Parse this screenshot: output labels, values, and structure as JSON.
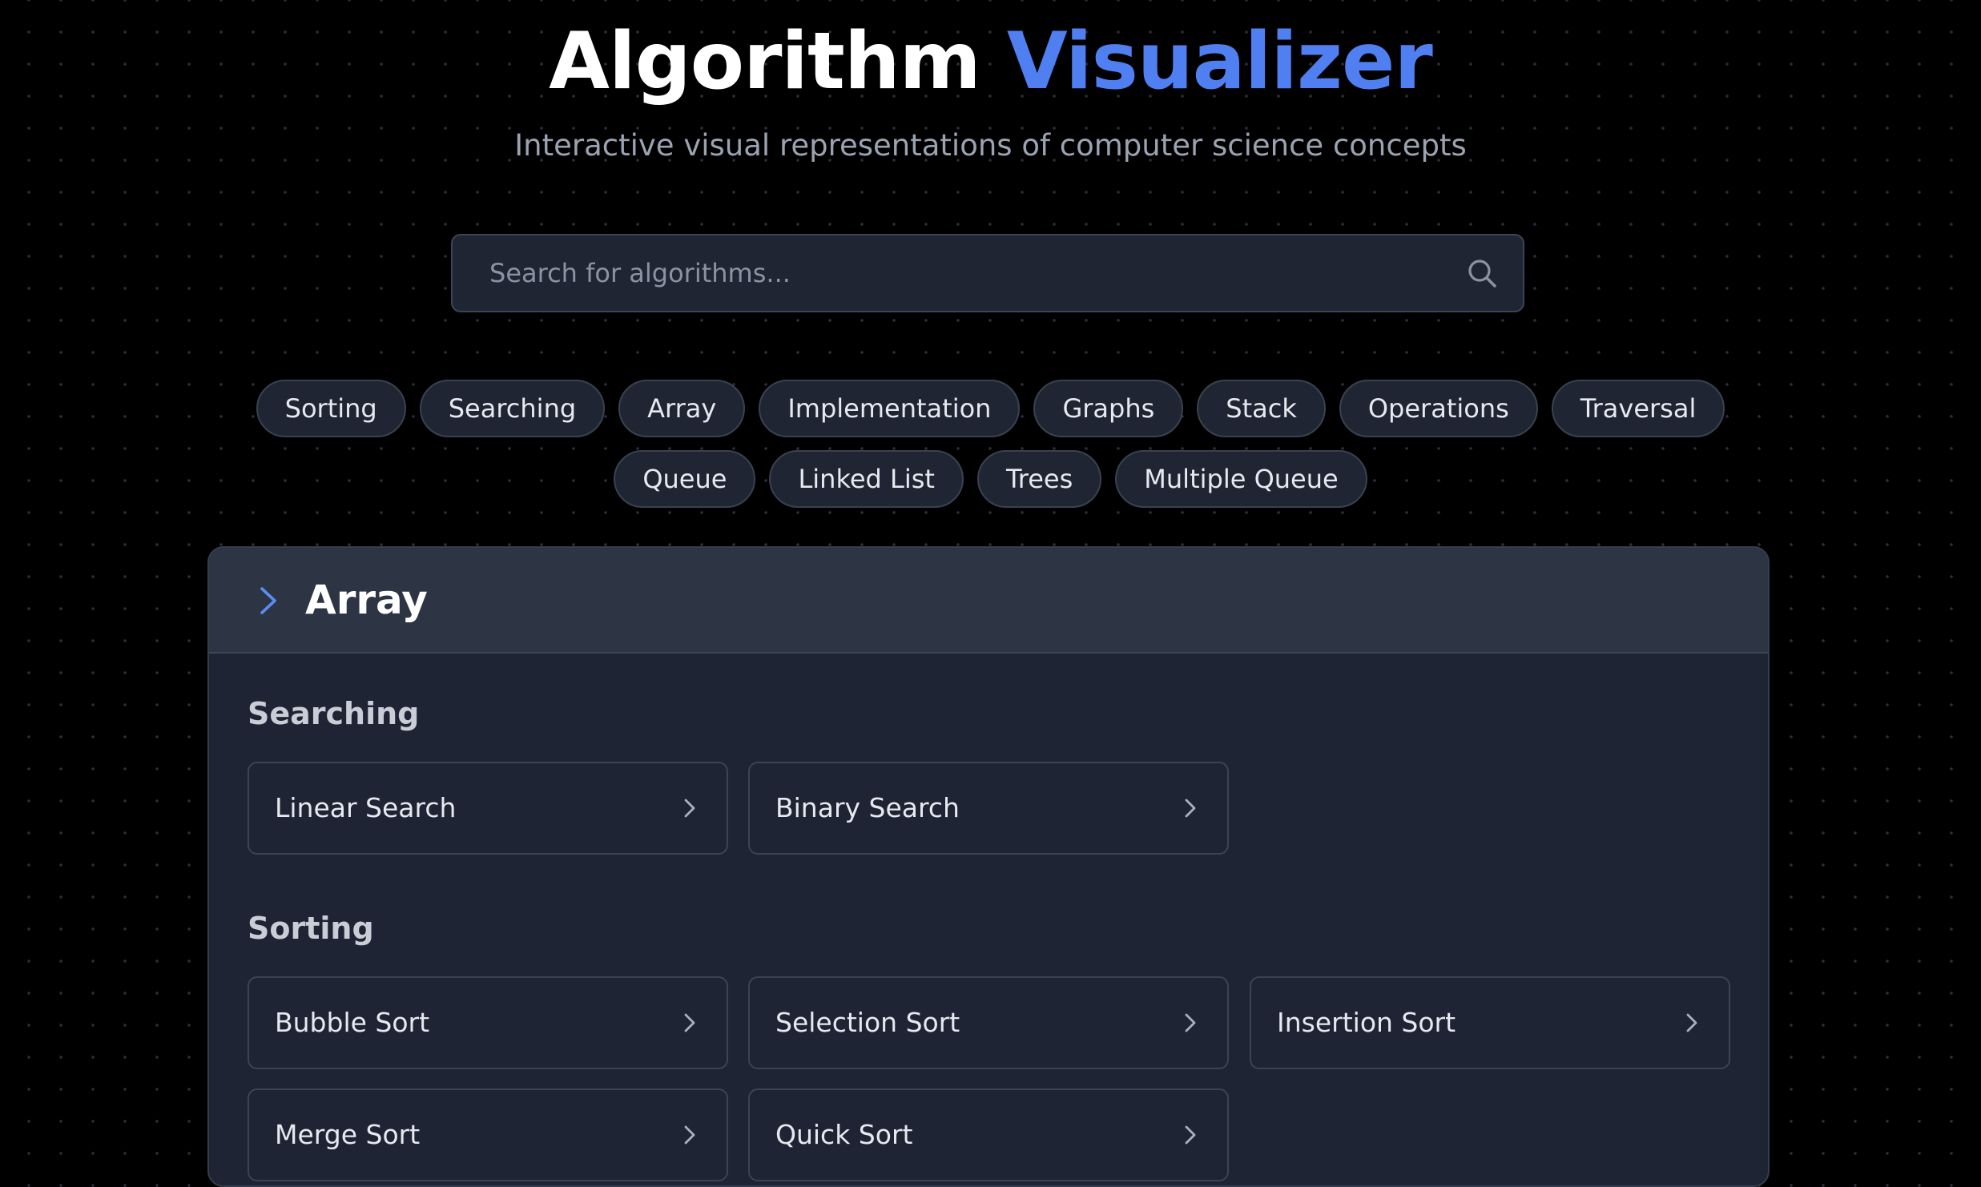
{
  "header": {
    "title_main": "Algorithm",
    "title_accent": "Visualizer",
    "subtitle": "Interactive visual representations of computer science concepts"
  },
  "search": {
    "placeholder": "Search for algorithms...",
    "value": "",
    "icon": "search-icon"
  },
  "filters": {
    "row1": [
      "Sorting",
      "Searching",
      "Array",
      "Implementation",
      "Graphs",
      "Stack",
      "Operations",
      "Traversal"
    ],
    "row2": [
      "Queue",
      "Linked List",
      "Trees",
      "Multiple Queue"
    ]
  },
  "category": {
    "title": "Array",
    "icon": "chevron-right-icon",
    "sections": [
      {
        "heading": "Searching",
        "items": [
          "Linear Search",
          "Binary Search"
        ]
      },
      {
        "heading": "Sorting",
        "items": [
          "Bubble Sort",
          "Selection Sort",
          "Insertion Sort",
          "Merge Sort",
          "Quick Sort"
        ]
      }
    ]
  },
  "colors": {
    "background": "#000000",
    "accent": "#4f7ff0",
    "panel": "#1e2433",
    "panel_header": "#2d3444",
    "chip": "#1f2533",
    "text_primary": "#ffffff",
    "text_muted": "#9aa3b2"
  }
}
